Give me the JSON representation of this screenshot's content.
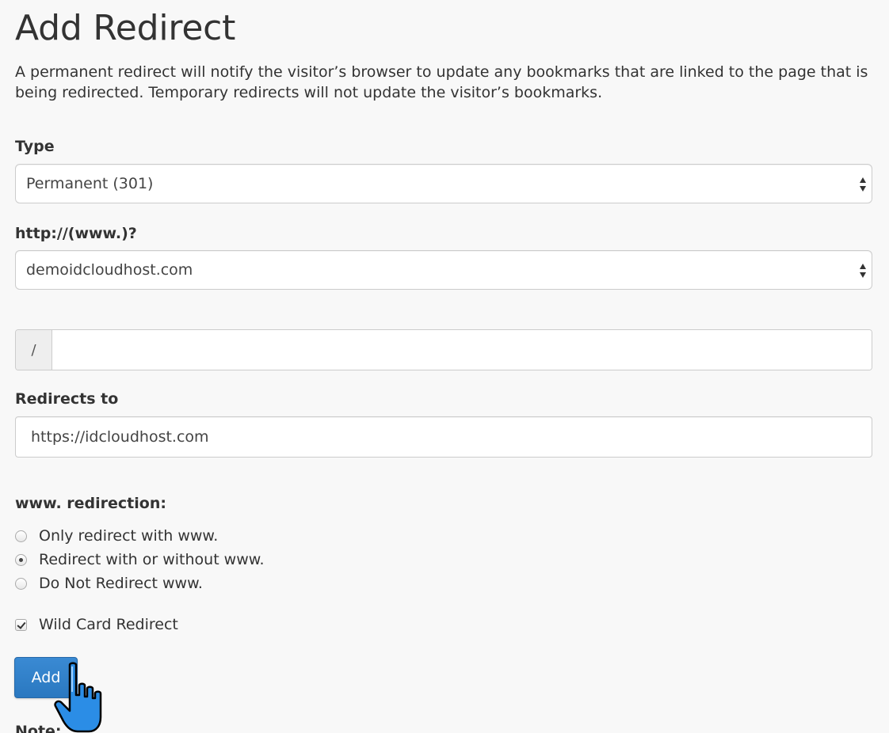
{
  "page": {
    "title": "Add Redirect",
    "description": "A permanent redirect will notify the visitor’s browser to update any bookmarks that are linked to the page that is being redirected. Temporary redirects will not update the visitor’s bookmarks."
  },
  "form": {
    "type": {
      "label": "Type",
      "selected": "Permanent (301)"
    },
    "domain": {
      "label": "http://(www.)?",
      "selected": "demoidcloudhost.com"
    },
    "path": {
      "prefix": "/",
      "value": ""
    },
    "redirects_to": {
      "label": "Redirects to",
      "value": "https://idcloudhost.com"
    },
    "www_redirection": {
      "label": "www. redirection:",
      "options": [
        {
          "label": "Only redirect with www.",
          "checked": false
        },
        {
          "label": "Redirect with or without www.",
          "checked": true
        },
        {
          "label": "Do Not Redirect www.",
          "checked": false
        }
      ]
    },
    "wildcard": {
      "label": "Wild Card Redirect",
      "checked": true
    },
    "add_button_label": "Add",
    "notes_fragment": "Note:"
  },
  "colors": {
    "primary_button": "#2f80c8",
    "background": "#f8f8f8",
    "border": "#cccccc"
  },
  "icons": {
    "select_arrows": "updown-arrows-icon",
    "cursor": "hand-pointer-icon"
  }
}
